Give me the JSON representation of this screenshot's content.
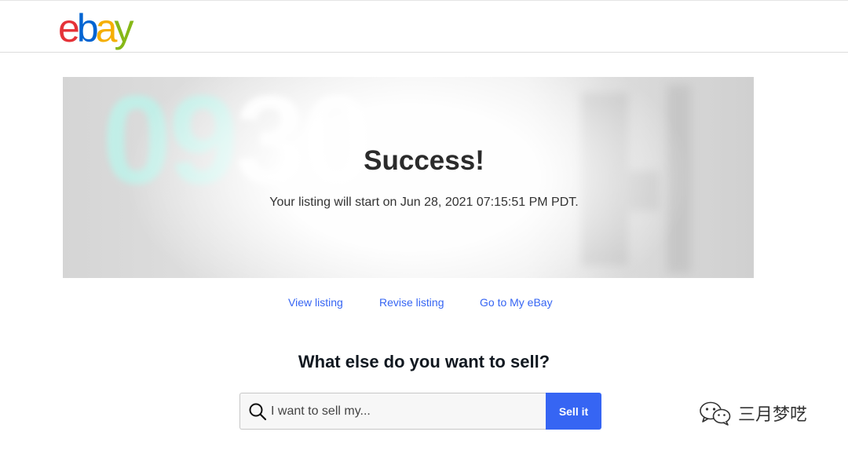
{
  "header": {
    "logo_letters": [
      {
        "char": "e",
        "color": "#e53238"
      },
      {
        "char": "b",
        "color": "#0064d2"
      },
      {
        "char": "a",
        "color": "#f5af02"
      },
      {
        "char": "y",
        "color": "#86b817"
      }
    ]
  },
  "hero": {
    "time_digits_a": "09",
    "time_digits_b": "30",
    "title": "Success!",
    "message": "Your listing will start on Jun 28, 2021 07:15:51 PM PDT."
  },
  "links": {
    "view_listing": "View listing",
    "revise_listing": "Revise listing",
    "my_ebay": "Go to My eBay"
  },
  "sell": {
    "heading": "What else do you want to sell?",
    "placeholder": "I want to sell my...",
    "button_label": "Sell it"
  },
  "watermark": {
    "text": "三月梦呓"
  },
  "colors": {
    "accent": "#3665f3"
  }
}
